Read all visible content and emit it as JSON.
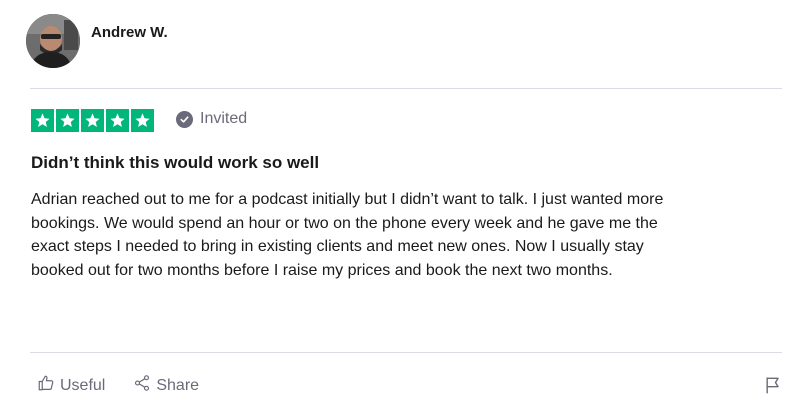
{
  "reviewer": {
    "name": "Andrew W.",
    "avatar_icon": "person-photo"
  },
  "rating": {
    "stars": 5,
    "max_stars": 5,
    "star_color": "#00b67a",
    "star_icon": "star-icon"
  },
  "badge": {
    "label": "Invited",
    "icon": "check-circle-icon",
    "color": "#6a6a7a"
  },
  "review": {
    "title": "Didn’t think this would work so well",
    "body_lines": [
      "Adrian reached out to me for a podcast initially but I didn’t want to talk.  I just wanted more",
      "bookings.  We would spend an hour or two on the phone every week and he gave me the",
      "exact steps I needed to bring in existing clients and meet new ones.  Now I usually stay",
      "booked out for two months before I raise my prices and book the next two months."
    ]
  },
  "actions": {
    "useful_label": "Useful",
    "useful_icon": "thumbs-up-icon",
    "share_label": "Share",
    "share_icon": "share-icon",
    "report_icon": "flag-icon"
  }
}
